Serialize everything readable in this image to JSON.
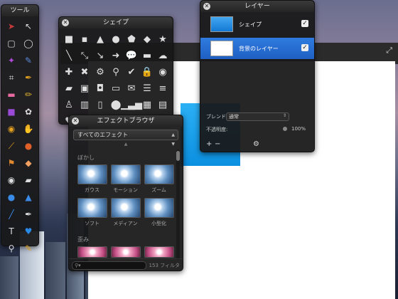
{
  "tools_panel": {
    "title": "ツール",
    "tools": [
      {
        "icon": "arrow-select-icon",
        "glyph": "➤",
        "color": "#c43a3a"
      },
      {
        "icon": "move-arrow-icon",
        "glyph": "↖",
        "color": "#ddd"
      },
      {
        "icon": "rect-select-icon",
        "glyph": "▢",
        "color": "#ddd"
      },
      {
        "icon": "ellipse-select-icon",
        "glyph": "◯",
        "color": "#ddd"
      },
      {
        "icon": "magic-wand-icon",
        "glyph": "✦",
        "color": "#b04ad8"
      },
      {
        "icon": "lasso-icon",
        "glyph": "✎",
        "color": "#5a8bd8"
      },
      {
        "icon": "crop-icon",
        "glyph": "⌗",
        "color": "#ddd"
      },
      {
        "icon": "eyedropper-icon",
        "glyph": "✒",
        "color": "#e0a020"
      },
      {
        "icon": "eraser-icon",
        "glyph": "▬",
        "color": "#e76aa0"
      },
      {
        "icon": "pencil-icon",
        "glyph": "✏",
        "color": "#e0b030"
      },
      {
        "icon": "purple-brush-icon",
        "glyph": "■",
        "color": "#9b4ad8"
      },
      {
        "icon": "stamp-icon",
        "glyph": "✿",
        "color": "#ddd"
      },
      {
        "icon": "paint-bucket-icon",
        "glyph": "◉",
        "color": "#e3a020"
      },
      {
        "icon": "smudge-icon",
        "glyph": "✋",
        "color": "#e8e8e8"
      },
      {
        "icon": "brush-icon",
        "glyph": "⟋",
        "color": "#e8a020"
      },
      {
        "icon": "burn-icon",
        "glyph": "●",
        "color": "#e0602a"
      },
      {
        "icon": "clone-stamp-icon",
        "glyph": "⚑",
        "color": "#e08830"
      },
      {
        "icon": "bandage-icon",
        "glyph": "◆",
        "color": "#f0a060"
      },
      {
        "icon": "red-eye-icon",
        "glyph": "◉",
        "color": "#ddd"
      },
      {
        "icon": "sponge-icon",
        "glyph": "▰",
        "color": "#ddd"
      },
      {
        "icon": "blur-drop-icon",
        "glyph": "●",
        "color": "#3a8ae8"
      },
      {
        "icon": "sharpen-icon",
        "glyph": "▲",
        "color": "#3a8ae8"
      },
      {
        "icon": "line-tool-icon",
        "glyph": "╱",
        "color": "#3a8ae8"
      },
      {
        "icon": "pen-tool-icon",
        "glyph": "✒",
        "color": "#ddd"
      },
      {
        "icon": "text-tool-icon",
        "glyph": "T",
        "color": "#ddd"
      },
      {
        "icon": "heart-shape-icon",
        "glyph": "♥",
        "color": "#2a8ae8"
      },
      {
        "icon": "zoom-icon",
        "glyph": "⚲",
        "color": "#ddd"
      },
      {
        "icon": "color-picker-icon",
        "glyph": "✎",
        "color": "#e0a020"
      }
    ]
  },
  "shapes_panel": {
    "title": "シェイプ",
    "shapes": [
      {
        "icon": "square-shape-icon",
        "glyph": "■"
      },
      {
        "icon": "rounded-square-shape-icon",
        "glyph": "▪"
      },
      {
        "icon": "triangle-shape-icon",
        "glyph": "▲"
      },
      {
        "icon": "circle-shape-icon",
        "glyph": "●"
      },
      {
        "icon": "pentagon-shape-icon",
        "glyph": "⬟"
      },
      {
        "icon": "diamond-shape-icon",
        "glyph": "◆"
      },
      {
        "icon": "star-shape-icon",
        "glyph": "★"
      },
      {
        "icon": "line-shape-icon",
        "glyph": "╲"
      },
      {
        "icon": "double-arrow-shape-icon",
        "glyph": "⤡"
      },
      {
        "icon": "diagonal-arrow-shape-icon",
        "glyph": "↘"
      },
      {
        "icon": "right-arrow-shape-icon",
        "glyph": "➜"
      },
      {
        "icon": "speech-bubble-shape-icon",
        "glyph": "💬"
      },
      {
        "icon": "speech-square-shape-icon",
        "glyph": "▬"
      },
      {
        "icon": "cloud-shape-icon",
        "glyph": "☁"
      },
      {
        "icon": "plus-shape-icon",
        "glyph": "✚"
      },
      {
        "icon": "x-shape-icon",
        "glyph": "✖"
      },
      {
        "icon": "gear-shape-icon",
        "glyph": "⚙"
      },
      {
        "icon": "magnifier-shape-icon",
        "glyph": "⚲"
      },
      {
        "icon": "check-shape-icon",
        "glyph": "✔"
      },
      {
        "icon": "lock-shape-icon",
        "glyph": "🔒"
      },
      {
        "icon": "eye-shape-icon",
        "glyph": "◉"
      },
      {
        "icon": "folder-shape-icon",
        "glyph": "▰"
      },
      {
        "icon": "image-shape-icon",
        "glyph": "▣"
      },
      {
        "icon": "camera-shape-icon",
        "glyph": "◘"
      },
      {
        "icon": "monitor-shape-icon",
        "glyph": "▭"
      },
      {
        "icon": "mail-shape-icon",
        "glyph": "✉"
      },
      {
        "icon": "list-shape-icon",
        "glyph": "☰"
      },
      {
        "icon": "lines-shape-icon",
        "glyph": "≡"
      },
      {
        "icon": "person-shape-icon",
        "glyph": "♙"
      },
      {
        "icon": "building-shape-icon",
        "glyph": "▥"
      },
      {
        "icon": "phone-shape-icon",
        "glyph": "▯"
      },
      {
        "icon": "pin-shape-icon",
        "glyph": "⬤"
      },
      {
        "icon": "bars-shape-icon",
        "glyph": "▁▃▅"
      },
      {
        "icon": "calendar-shape-icon",
        "glyph": "▦"
      },
      {
        "icon": "document-shape-icon",
        "glyph": "▤"
      },
      {
        "icon": "heart-shape-icon",
        "glyph": "♥"
      },
      {
        "icon": "tag-shape-icon",
        "glyph": "●"
      }
    ]
  },
  "effects_panel": {
    "title": "エフェクトブラウザ",
    "filter_selected": "すべてのエフェクト",
    "categories": [
      {
        "label": "ぼかし",
        "items": [
          "ガウス",
          "モーション",
          "ズーム",
          "ソフト",
          "メディアン",
          "小型化"
        ]
      },
      {
        "label": "歪み",
        "items": [
          "",
          "",
          ""
        ]
      }
    ],
    "count_label": "153 フィルタ"
  },
  "layers_panel": {
    "title": "レイヤー",
    "layers": [
      {
        "name": "シェイプ",
        "visible_check": "✓"
      },
      {
        "name": "背景のレイヤー",
        "visible_check": "✓"
      }
    ],
    "blend_label": "ブレンド:",
    "blend_value": "通常",
    "opacity_label": "不透明度:",
    "opacity_value": "100%",
    "add_button": "+",
    "remove_button": "−",
    "gear_button": "⚙"
  },
  "colors": {
    "selected_layer": "#1f5fc2",
    "canvas_shape": "#0b8fe0"
  }
}
